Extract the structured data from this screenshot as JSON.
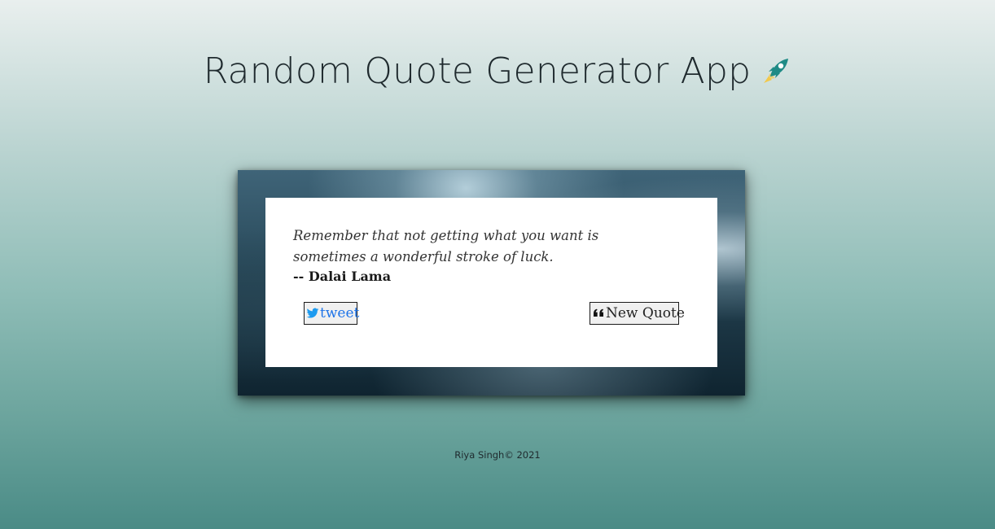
{
  "header": {
    "title": "Random Quote Generator App",
    "title_icon": "rocket-icon"
  },
  "quote": {
    "text": "Remember that not getting what you want is sometimes a wonderful stroke of luck.",
    "author": "-- Dalai Lama"
  },
  "actions": {
    "tweet_label": "tweet",
    "tweet_icon": "twitter-icon",
    "new_quote_label": "New Quote",
    "new_quote_icon": "quote-left-icon"
  },
  "footer": {
    "text": "Riya Singh© 2021"
  },
  "colors": {
    "tweet_link": "#1d73e8",
    "rocket_body": "#1f8b86",
    "rocket_flame": "#f2c94c"
  }
}
